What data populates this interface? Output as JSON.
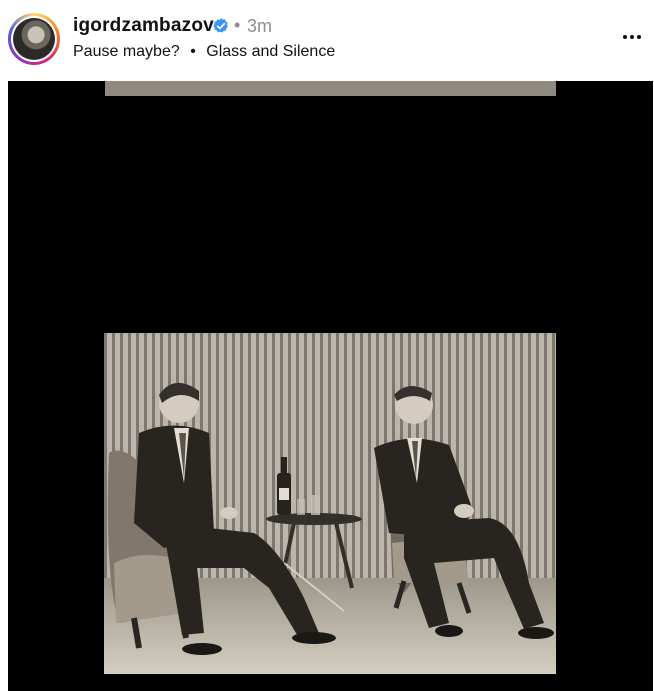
{
  "post": {
    "username": "igordzambazov",
    "separator": "•",
    "time": "3m",
    "caption": "Pause maybe?",
    "caption_separator": "•",
    "audio": "Glass and Silence"
  },
  "colors": {
    "verified": "#3897f0",
    "meta_gray": "#8e8e8e",
    "media_bg": "#000000"
  },
  "icons": {
    "verified": "verified-badge-icon",
    "more": "more-options-icon"
  }
}
